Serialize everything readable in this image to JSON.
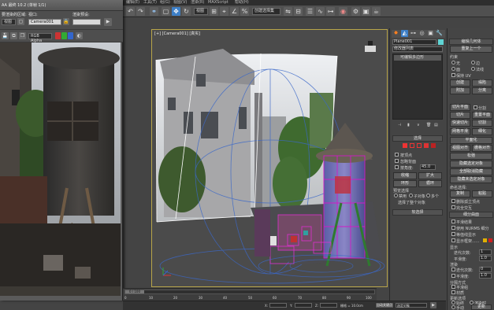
{
  "menubar": {
    "items": [
      "编辑(E)",
      "工具(T)",
      "组(G)",
      "视图(V)",
      "渲染(R)",
      "MAXScript",
      "帮助(H)"
    ]
  },
  "toolbar": {
    "view_dropdown": "视图",
    "selection_set": "创建选择集"
  },
  "render_window": {
    "title": "AA 最终 10.2 (单帧 1/1)",
    "row1": {
      "area_label": "要渲染的区域:",
      "area_value": "视图",
      "viewport_label": "视口:",
      "viewport_value": "Camera001",
      "preset_label": "渲染预设:",
      "preset_value": ""
    },
    "row2": {
      "channel_value": "RGB Alpha"
    },
    "row3": {
      "output_label": "输出:",
      "output_value": ""
    }
  },
  "viewport": {
    "label": "[+] [Camera001] [真实]"
  },
  "command_panel": {
    "tabs_icons": [
      "create-tab",
      "modify-tab",
      "hierarchy-tab",
      "motion-tab",
      "display-tab",
      "utilities-tab"
    ],
    "object_name": "Plane001",
    "modifier_list_label": "修改器列表",
    "stack_item": "可编辑多边形",
    "rollout_selection": "选择",
    "by_vertex": "按顶点",
    "ignore_backfacing": "忽略背面",
    "by_angle": "按角度:",
    "angle_value": "45.0",
    "shrink": "收缩",
    "grow": "扩大",
    "ring": "环形",
    "loop": "循环",
    "preview_selection": "预览选择",
    "off": "禁用",
    "subobj": "子对象",
    "multi": "多个",
    "selected_count": "选择了整个对象",
    "soft_selection": "软选择"
  },
  "right_panel": {
    "header_title": "编辑几何体",
    "header_sub": "重复上一个",
    "constraints": "约束",
    "none": "无",
    "edge": "边",
    "face": "面",
    "normal": "法线",
    "preserve_uvs": "保持 UV",
    "create": "创建",
    "collapse": "塌陷",
    "attach": "附加",
    "detach": "分离",
    "slice_plane": "切片平面",
    "split": "分割",
    "slice": "切片",
    "reset_plane": "重置平面",
    "quickslice": "快速切片",
    "cut": "切割",
    "meshsmooth": "网格平滑",
    "tessellate": "细化",
    "make_planar": "平面化",
    "view_align": "视图对齐",
    "grid_align": "栅格对齐",
    "relax": "松弛",
    "hide_selected": "隐藏选定对象",
    "unhide_all": "全部取消隐藏",
    "hide_unselected": "隐藏未选定对象",
    "named_selections": "命名选择:",
    "copy": "复制",
    "paste": "粘贴",
    "delete_isolated": "删除孤立顶点",
    "full_interactivity": "完全交互",
    "subdivision_surface": "细分曲面",
    "smooth_result": "平滑结果",
    "use_nurms": "使用 NURMS 细分",
    "isoline_display": "等值线显示",
    "show_cage": "显示框架......",
    "display_label": "显示",
    "iterations_label": "迭代次数:",
    "iterations_value": "1",
    "smoothness_label": "平滑度:",
    "smoothness_value": "1.0",
    "render_label": "渲染",
    "r_iterations_value": "0",
    "r_smoothness_value": "1.0",
    "separate_by": "分隔方式",
    "smoothing_groups": "平滑组",
    "materials": "材质",
    "update_options": "更新选项",
    "always": "始终",
    "when_rendering": "渲染时",
    "manually": "手动",
    "update": "更新",
    "subdivision_displacement": "细分置换"
  },
  "timeline": {
    "ticks": [
      "0",
      "10",
      "20",
      "30",
      "40",
      "50",
      "60",
      "70",
      "80",
      "90",
      "100"
    ],
    "frame_display": "0 / 100"
  },
  "statusbar": {
    "x_label": "X:",
    "y_label": "Y:",
    "z_label": "Z:",
    "grid": "栅格 = 10.0cm",
    "autokey": "自动关键点",
    "selected": "选定对象"
  },
  "colors": {
    "viewport_border": "#b8a54a",
    "accent_blue": "#3d7fc7",
    "swatch_yellow": "#e0b000",
    "swatch_red": "#d02020"
  }
}
